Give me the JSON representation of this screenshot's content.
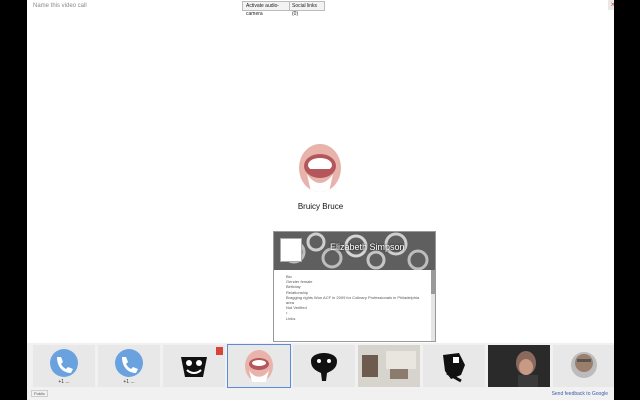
{
  "topbar": {
    "name_label": "Name this video call",
    "tag_button": "Activate audio-camera",
    "toggle_button": "Social links (0)",
    "close_label": "×"
  },
  "main": {
    "participant_name": "Bruicy Bruce"
  },
  "profile_card": {
    "name": "Elizabeth Simpson",
    "lines": [
      "Bio",
      "",
      "Gender  female",
      "Birthday",
      "Relationship",
      "Bragging rights  Won ACF in 2009 for Culinary Professionals in Philadelphia",
      "area",
      "Not Verified",
      "•",
      "",
      "Links"
    ]
  },
  "strip": {
    "tiles": [
      {
        "label": "+1 ...",
        "kind": "phone"
      },
      {
        "label": "+1 ...",
        "kind": "phone"
      },
      {
        "label": "",
        "kind": "mask"
      },
      {
        "label": "",
        "kind": "avatar"
      },
      {
        "label": "",
        "kind": "elephant"
      },
      {
        "label": "",
        "kind": "room"
      },
      {
        "label": "",
        "kind": "warrior"
      },
      {
        "label": "",
        "kind": "woman"
      },
      {
        "label": "",
        "kind": "man"
      }
    ],
    "footer_left": "Public",
    "footer_right": "Send feedback to Google"
  },
  "colors": {
    "accent": "#5b8ae0",
    "phone": "#6aa2e0",
    "danger": "#d9443a"
  }
}
